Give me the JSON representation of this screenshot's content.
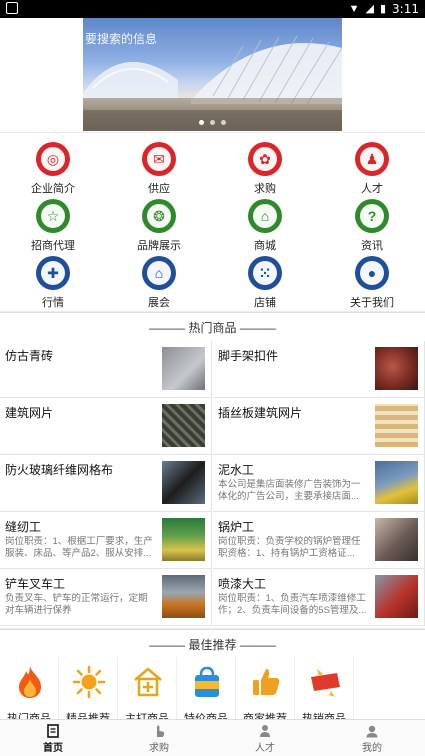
{
  "status_bar": {
    "time": "3:11"
  },
  "banner": {
    "search_hint": "要搜索的信息",
    "slides": 3,
    "active_slide": 1
  },
  "category_grid": [
    {
      "label": "企业简介",
      "icon": "company-icon",
      "glyph": "◎",
      "color": "red"
    },
    {
      "label": "供应",
      "icon": "supply-icon",
      "glyph": "✉",
      "color": "red"
    },
    {
      "label": "求购",
      "icon": "paw-icon",
      "glyph": "✿",
      "color": "red"
    },
    {
      "label": "人才",
      "icon": "person-icon",
      "glyph": "♟",
      "color": "red"
    },
    {
      "label": "招商代理",
      "icon": "star-icon",
      "glyph": "☆",
      "color": "green"
    },
    {
      "label": "品牌展示",
      "icon": "brand-icon",
      "glyph": "❂",
      "color": "green"
    },
    {
      "label": "商城",
      "icon": "house-icon",
      "glyph": "⌂",
      "color": "green"
    },
    {
      "label": "资讯",
      "icon": "question-icon",
      "glyph": "?",
      "color": "green"
    },
    {
      "label": "行情",
      "icon": "puzzle-icon",
      "glyph": "✚",
      "color": "blue"
    },
    {
      "label": "展会",
      "icon": "exhibition-icon",
      "glyph": "⌂",
      "color": "blue"
    },
    {
      "label": "店铺",
      "icon": "grid-dots-icon",
      "glyph": "⁙",
      "color": "blue"
    },
    {
      "label": "关于我们",
      "icon": "user-circle-icon",
      "glyph": "●",
      "color": "blue"
    }
  ],
  "hot_section": {
    "title": "——— 热门商品 ———"
  },
  "products": [
    {
      "title": "仿古青砖",
      "desc": "",
      "thumb_color": "#8c8f93",
      "thumb_color2": "#c5c8cc"
    },
    {
      "title": "脚手架扣件",
      "desc": "",
      "thumb_color": "#7a2b22",
      "thumb_color2": "#b9574a"
    },
    {
      "title": "建筑网片",
      "desc": "",
      "thumb_color": "#3a3d33",
      "thumb_color2": "#6b6e62"
    },
    {
      "title": "插丝板建筑网片",
      "desc": "",
      "thumb_color": "#d9b77a",
      "thumb_color2": "#f1e2c2"
    },
    {
      "title": "防火玻璃纤维网格布",
      "desc": "",
      "thumb_color": "#1d1d1d",
      "thumb_color2": "#6a7d90"
    },
    {
      "title": "泥水工",
      "desc": "本公司是集店面装修广告装饰为一体化的广告公司，主要承接店面...",
      "thumb_color": "#4a6e9a",
      "thumb_color2": "#e2c23a"
    },
    {
      "title": "缝纫工",
      "desc": "岗位职责：1、根据工厂要求，生产服装、床品、等产品2、服从安排...",
      "thumb_color": "#2c7a3a",
      "thumb_color2": "#d9c34a"
    },
    {
      "title": "锅炉工",
      "desc": "岗位职责：负责学校的锅炉管理任职资格：1、持有锅炉工资格证...",
      "thumb_color": "#6a5a55",
      "thumb_color2": "#c8b8a8"
    },
    {
      "title": "铲车叉车工",
      "desc": "负责叉车、铲车的正常运行，定期对车辆进行保养",
      "thumb_color": "#c9731f",
      "thumb_color2": "#5c6b78"
    },
    {
      "title": "喷漆大工",
      "desc": "岗位职责：1、负责汽车喷漆维修工作；2、负责车间设备的5S管理及...",
      "thumb_color": "#b8322a",
      "thumb_color2": "#8a97a6"
    }
  ],
  "best_section": {
    "title": "——— 最佳推荐 ———"
  },
  "best_items": [
    {
      "label": "热门商品",
      "icon": "flame-icon",
      "color": "#f25b16"
    },
    {
      "label": "精品推荐",
      "icon": "sun-icon",
      "color": "#f5a21a"
    },
    {
      "label": "主打商品",
      "icon": "shop-plus-icon",
      "color": "#e8a317"
    },
    {
      "label": "特价商品",
      "icon": "sale-bag-icon",
      "color": "#2a8fd6"
    },
    {
      "label": "商家推荐",
      "icon": "thumbs-up-icon",
      "color": "#f0a020"
    },
    {
      "label": "热销商品",
      "icon": "hot-tag-icon",
      "color": "#e23a2a"
    }
  ],
  "tabs": [
    {
      "label": "首页",
      "icon": "home-doc-icon",
      "active": true
    },
    {
      "label": "求购",
      "icon": "hand-icon",
      "active": false
    },
    {
      "label": "人才",
      "icon": "person-icon",
      "active": false
    },
    {
      "label": "我的",
      "icon": "profile-icon",
      "active": false
    }
  ]
}
